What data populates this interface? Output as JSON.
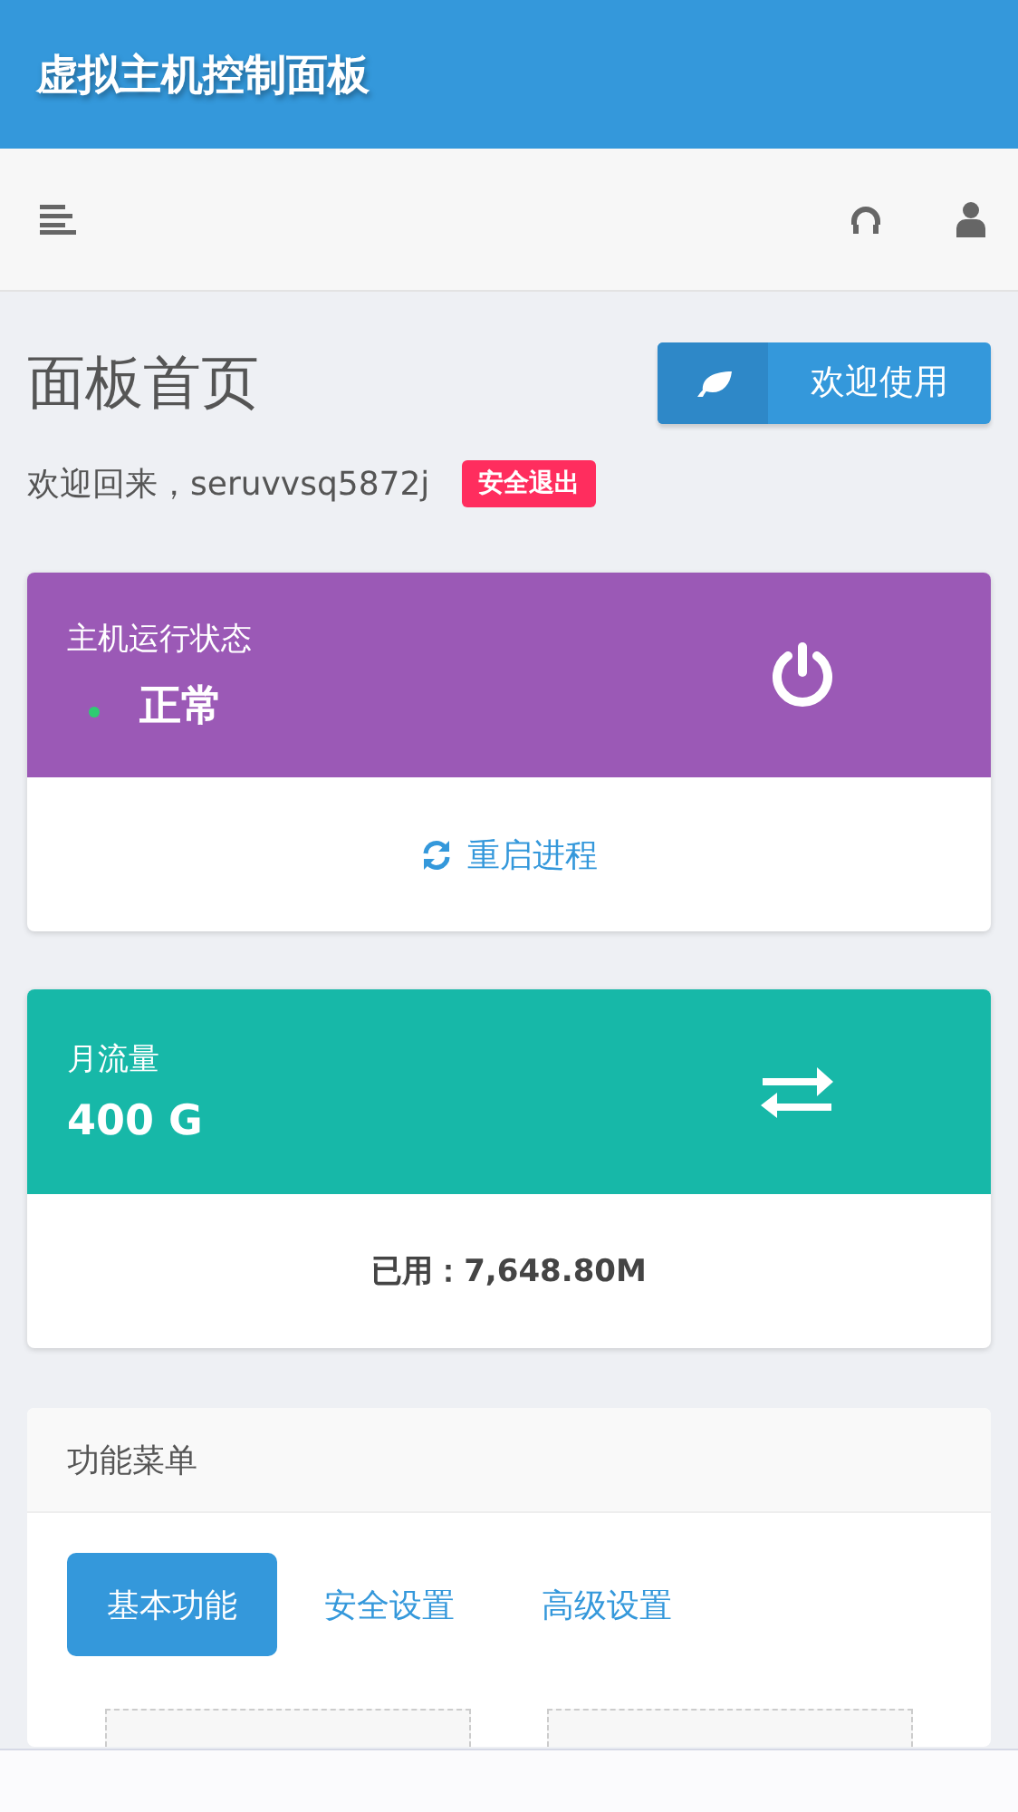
{
  "header": {
    "title": "虚拟主机控制面板"
  },
  "page": {
    "title": "面板首页",
    "welcome_button": "欢迎使用",
    "greeting": "欢迎回来，seruvvsq5872j",
    "logout": "安全退出"
  },
  "status_card": {
    "label": "主机运行状态",
    "value": "正常",
    "action": "重启进程"
  },
  "traffic_card": {
    "label": "月流量",
    "value": "400 G",
    "used": "已用：7,648.80M"
  },
  "menu": {
    "title": "功能菜单",
    "tabs": [
      {
        "label": "基本功能",
        "selected": true
      },
      {
        "label": "安全设置",
        "selected": false
      },
      {
        "label": "高级设置",
        "selected": false
      }
    ]
  }
}
